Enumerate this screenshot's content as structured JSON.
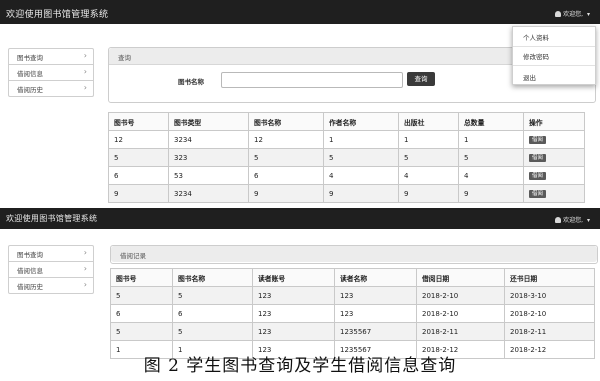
{
  "top": {
    "brand": "欢迎使用图书馆管理系统",
    "user_label": "欢迎您,",
    "caret": "▾",
    "dropdown": [
      "个人资料",
      "修改密码",
      "退出"
    ]
  },
  "sidebar": {
    "items": [
      {
        "label": "图书查询"
      },
      {
        "label": "借阅信息"
      },
      {
        "label": "借阅历史"
      }
    ],
    "chevron": "›"
  },
  "search_panel": {
    "title": "查询",
    "label": "图书名称",
    "input_value": "",
    "button": "查询"
  },
  "books_table": {
    "headers": [
      "图书号",
      "图书类型",
      "图书名称",
      "作者名称",
      "出版社",
      "总数量",
      "操作"
    ],
    "action": "借阅",
    "rows": [
      [
        "12",
        "3234",
        "12",
        "1",
        "1",
        "1"
      ],
      [
        "5",
        "323",
        "5",
        "5",
        "5",
        "5"
      ],
      [
        "6",
        "53",
        "6",
        "4",
        "4",
        "4"
      ],
      [
        "9",
        "3234",
        "9",
        "9",
        "9",
        "9"
      ]
    ]
  },
  "bottom": {
    "brand": "欢迎使用图书馆管理系统",
    "user_label": "欢迎您,",
    "caret": "▾"
  },
  "borrow_panel": {
    "title": "借阅记录"
  },
  "borrow_table": {
    "headers": [
      "图书号",
      "图书名称",
      "读者账号",
      "读者名称",
      "借阅日期",
      "还书日期"
    ],
    "rows": [
      [
        "5",
        "5",
        "123",
        "123",
        "2018-2-10",
        "2018-3-10"
      ],
      [
        "6",
        "6",
        "123",
        "123",
        "2018-2-10",
        "2018-2-10"
      ],
      [
        "5",
        "5",
        "123",
        "1235567",
        "2018-2-11",
        "2018-2-11"
      ],
      [
        "1",
        "1",
        "123",
        "1235567",
        "2018-2-12",
        "2018-2-12"
      ]
    ]
  },
  "caption": "图 2 学生图书查询及学生借阅信息查询"
}
